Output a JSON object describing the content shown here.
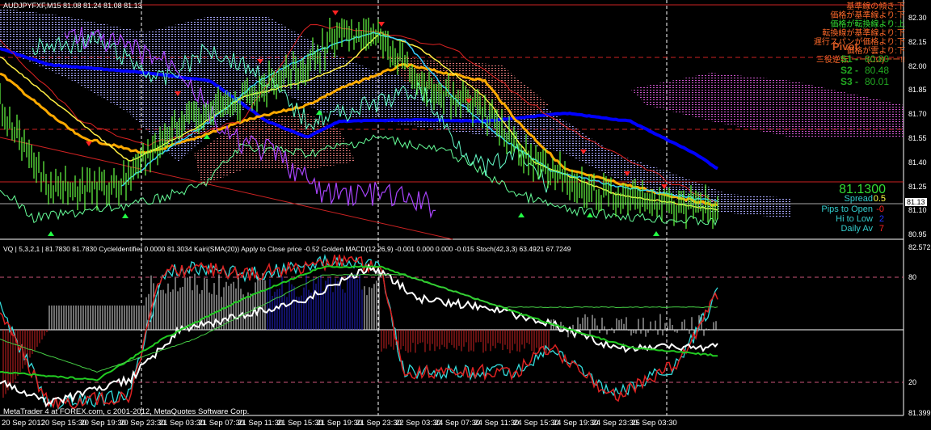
{
  "window": {
    "title": "AUDJPYFXF,M15  81.08 81.24 81.08 81.13",
    "copyright": "MetaTrader 4 at FOREX.com, c 2001-2012, MetaQuotes Software Corp."
  },
  "signals": [
    {
      "text": "基準線の傾き:下",
      "color": "#ff6a2a"
    },
    {
      "text": "価格が基準線より:下",
      "color": "#ff6a2a"
    },
    {
      "text": "価格が転換線より:上",
      "color": "#33dd33"
    },
    {
      "text": "転換線が基準線より:下",
      "color": "#ff6a2a"
    },
    {
      "text": "遅行スパンが価格より:下",
      "color": "#ff6a2a"
    },
    {
      "text": "価格が雲より:下",
      "color": "#ff6a2a"
    },
    {
      "text": "三役逆転 ーー(ΩΩ)ーー!!",
      "color": "#ff6a2a"
    }
  ],
  "pivot": {
    "label": "Pivot",
    "s1_label": "S1 -",
    "s1": "80.80",
    "s2_label": "S2 -",
    "s2": "80.48",
    "s3_label": "S3 -",
    "s3": "80.01"
  },
  "panel": {
    "price": "81.1300",
    "spread_label": "Spread",
    "spread": "0.5",
    "pips_label": "Pips to Open",
    "pips": "-0",
    "hilo_label": "Hi to Low",
    "hilo": "2",
    "daily_label": "Daily Av",
    "daily": "7"
  },
  "main_axis": [
    "82.30",
    "82.15",
    "82.00",
    "81.85",
    "81.70",
    "81.55",
    "81.40",
    "81.25",
    "81.10",
    "80.95"
  ],
  "current_price": "81.13",
  "sub_axis": {
    "top": "82.5725",
    "high": "80",
    "low": "20",
    "bottom": "81.3999"
  },
  "sub_header": "VQ | 5,3,2,1 | 81.7830 81.7830  CycleIdentifier 0.0000 81.3034  Kairi(SMA(20)) Apply to Close price -0.52  Golden MACD(12,26,9) -0.001 0.000 0.000 -0.015  Stoch(42,3,3) 63.4921 67.7249",
  "time_axis": [
    "20 Sep 2012",
    "20 Sep 15:30",
    "20 Sep 19:30",
    "20 Sep 23:30",
    "21 Sep 03:30",
    "21 Sep 07:30",
    "21 Sep 11:30",
    "21 Sep 15:30",
    "21 Sep 19:30",
    "21 Sep 23:30",
    "22 Sep 03:30",
    "24 Sep 07:30",
    "24 Sep 11:30",
    "24 Sep 15:30",
    "24 Sep 19:30",
    "24 Sep 23:30",
    "25 Sep 03:30"
  ],
  "colors": {
    "bull": "#66ff66",
    "kijun": "#0000ff",
    "tenkan": "#ffaa00",
    "cloud_up": "#aa88ff",
    "cloud_dn": "#ff88aa"
  }
}
